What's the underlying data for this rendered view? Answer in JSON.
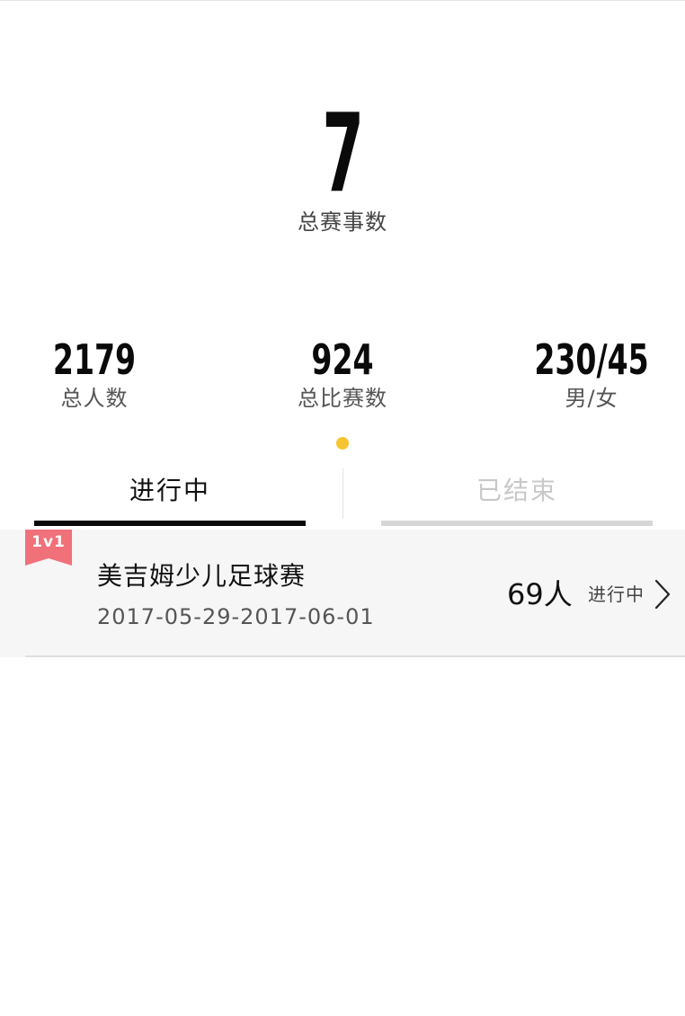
{
  "summary": {
    "total_events": "7",
    "total_events_label": "总赛事数"
  },
  "stats": [
    {
      "value": "2179",
      "label": "总人数"
    },
    {
      "value": "924",
      "label": "总比赛数"
    },
    {
      "value": "230/45",
      "label": "男/女"
    }
  ],
  "pager": {
    "active_color": "#f7c531"
  },
  "tabs": [
    {
      "label": "进行中",
      "active": true
    },
    {
      "label": "已结束",
      "active": false
    }
  ],
  "events": [
    {
      "badge": "1v1",
      "title": "美吉姆少儿足球赛",
      "date_range": "2017-05-29-2017-06-01",
      "participants": "69人",
      "status": "进行中"
    }
  ],
  "colors": {
    "badge": "#f0717a",
    "accent": "#f7c531",
    "tab_active": "#0a0a0a",
    "tab_inactive": "#d6d6d6"
  },
  "icons": {
    "row_chevron": "chevron-right-icon"
  }
}
